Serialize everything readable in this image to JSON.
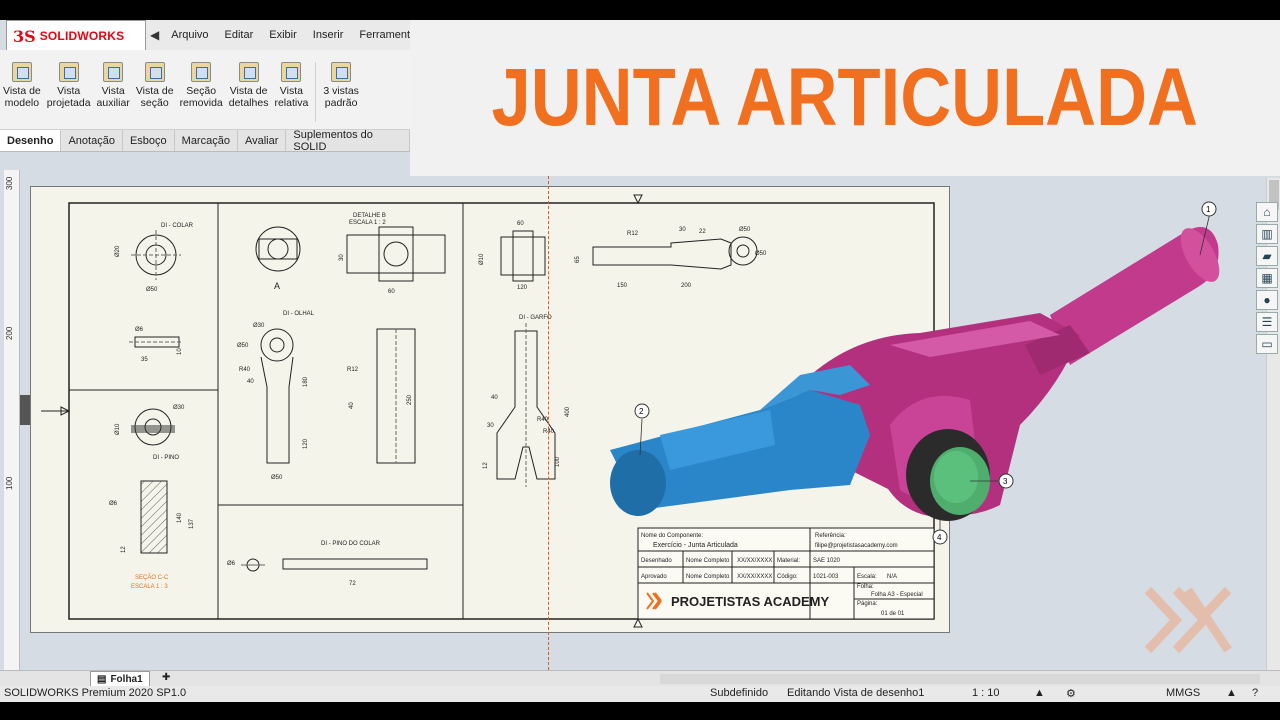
{
  "app": {
    "logo_prefix": "3S",
    "logo_text": "SOLIDWORKS",
    "status_product": "SOLIDWORKS Premium 2020 SP1.0"
  },
  "menu": {
    "items": [
      "Arquivo",
      "Editar",
      "Exibir",
      "Inserir",
      "Ferramenta"
    ]
  },
  "ribbon": {
    "buttons": [
      {
        "line1": "Vista de",
        "line2": "modelo",
        "icon": "model-view-icon"
      },
      {
        "line1": "Vista",
        "line2": "projetada",
        "icon": "projected-view-icon"
      },
      {
        "line1": "Vista",
        "line2": "auxiliar",
        "icon": "auxiliary-view-icon"
      },
      {
        "line1": "Vista de",
        "line2": "seção",
        "icon": "section-view-icon"
      },
      {
        "line1": "Seção",
        "line2": "removida",
        "icon": "removed-section-icon"
      },
      {
        "line1": "Vista de",
        "line2": "detalhes",
        "icon": "detail-view-icon"
      },
      {
        "line1": "Vista",
        "line2": "relativa",
        "icon": "relative-view-icon"
      },
      {
        "line1": "3 vistas",
        "line2": "padrão",
        "icon": "standard-3-views-icon"
      }
    ]
  },
  "tabs": [
    "Desenho",
    "Anotação",
    "Esboço",
    "Marcação",
    "Avaliar",
    "Suplementos do SOLID"
  ],
  "banner": {
    "title": "JUNTA ARTICULADA"
  },
  "ruler": {
    "marks": [
      "300",
      "200",
      "100"
    ]
  },
  "drawing": {
    "views": {
      "colar": "DI - COLAR",
      "olhal": "DI - OLHAL",
      "garfo": "DI - GARFO",
      "pino": "DI - PINO",
      "pino_colar": "DI - PINO DO COLAR",
      "detail": "DETALHE B",
      "detail_scale": "ESCALA 1 : 2",
      "section": "SEÇÃO C-C",
      "section_scale": "ESCALA 1 : 3",
      "label_a": "A"
    },
    "dims": {
      "d50": "Ø50",
      "d20": "Ø20",
      "d30": "Ø30",
      "d6": "Ø6",
      "d10": "Ø10",
      "v35": "35",
      "v10": "10",
      "v180": "180",
      "v120": "120",
      "v60": "60",
      "v40": "40",
      "v250": "250",
      "r12": "R12",
      "v150": "150",
      "v200": "200",
      "v100": "100",
      "v400": "400",
      "v12": "12",
      "v72": "72",
      "v140": "140",
      "v137": "137",
      "v22": "22",
      "r40": "R40",
      "v30": "30",
      "v65": "65"
    },
    "title_block": {
      "component_label": "Nome do Componente:",
      "component_value": "Exercício - Junta Articulada",
      "reference_label": "Referência:",
      "email": "filipe@projetistasacademy.com",
      "designed_label": "Desenhado",
      "approved_label": "Aprovado",
      "name_value": "Nome Completo",
      "date_value": "XX/XX/XXXX",
      "material_label": "Material:",
      "material_value": "SAE 1020",
      "code_label": "Código:",
      "code_value": "1021-003",
      "scale_label": "Escala:",
      "scale_value": "N/A",
      "sheet_label": "Folha:",
      "sheet_value": "Folha A3 - Especial",
      "page_label": "Página:",
      "page_value": "01 de 01",
      "brand": "PROJETISTAS ACADEMY"
    }
  },
  "model": {
    "balloons": [
      "1",
      "2",
      "3",
      "4"
    ],
    "colors": {
      "olhal": "#c23a8c",
      "garfo": "#2a86c9",
      "pino": "#4fae6e",
      "colar": "#2b2b2b"
    }
  },
  "bottom": {
    "sheet_tab": "Folha1"
  },
  "status": {
    "state": "Subdefinido",
    "editing": "Editando Vista de desenho1",
    "scale": "1 : 10",
    "units": "MMGS"
  },
  "side_icons": [
    "home-icon",
    "parts-icon",
    "folder-icon",
    "view-palette-icon",
    "appearance-icon",
    "properties-icon",
    "forum-icon"
  ]
}
